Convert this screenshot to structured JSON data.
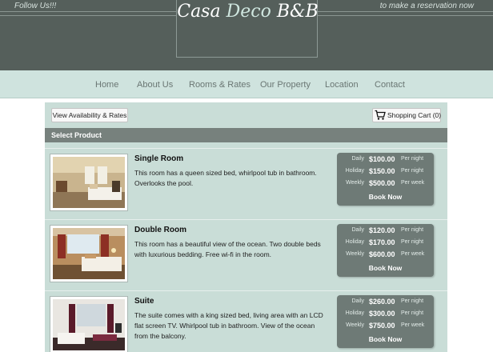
{
  "header": {
    "follow_text": "Follow Us!!!",
    "reserve_text": "to make a reservation now",
    "logo_casa": "Casa",
    "logo_deco": "Deco",
    "logo_bb": "B&B"
  },
  "nav": {
    "items": [
      {
        "label": "Home"
      },
      {
        "label": "About Us"
      },
      {
        "label": "Rooms & Rates"
      },
      {
        "label": "Our Property"
      },
      {
        "label": "Location"
      },
      {
        "label": "Contact"
      }
    ]
  },
  "toolbar": {
    "availability_label": "View Availability & Rates",
    "cart_label": "Shopping Cart (0)"
  },
  "section": {
    "title": "Select Product"
  },
  "products": [
    {
      "name": "Single Room",
      "description": "This room has a queen sized bed, whirlpool tub in bathroom. Overlooks the pool.",
      "rates": [
        {
          "label": "Daily",
          "amount": "$100.00",
          "unit": "Per night"
        },
        {
          "label": "Holiday",
          "amount": "$150.00",
          "unit": "Per night"
        },
        {
          "label": "Weekly",
          "amount": "$500.00",
          "unit": "Per week"
        }
      ],
      "book_label": "Book Now"
    },
    {
      "name": "Double Room",
      "description": "This room has a beautiful view of the ocean. Two double beds with luxurious bedding. Free wi-fi in the room.",
      "rates": [
        {
          "label": "Daily",
          "amount": "$120.00",
          "unit": "Per night"
        },
        {
          "label": "Holiday",
          "amount": "$170.00",
          "unit": "Per night"
        },
        {
          "label": "Weekly",
          "amount": "$600.00",
          "unit": "Per week"
        }
      ],
      "book_label": "Book Now"
    },
    {
      "name": "Suite",
      "description": "The suite comes with a king sized bed, living area with an LCD flat screen TV. Whirlpool tub in bathroom. View of the ocean from the balcony.",
      "rates": [
        {
          "label": "Daily",
          "amount": "$260.00",
          "unit": "Per night"
        },
        {
          "label": "Holiday",
          "amount": "$300.00",
          "unit": "Per night"
        },
        {
          "label": "Weekly",
          "amount": "$750.00",
          "unit": "Per week"
        }
      ],
      "book_label": "Book Now"
    }
  ],
  "icons": {
    "cart": "shopping-cart-icon"
  },
  "colors": {
    "header_bg": "#555f5b",
    "nav_bg": "#cfe3de",
    "panel_bg": "#c9ddd7",
    "section_bar": "#77817d",
    "price_box": "#6e7a76"
  }
}
